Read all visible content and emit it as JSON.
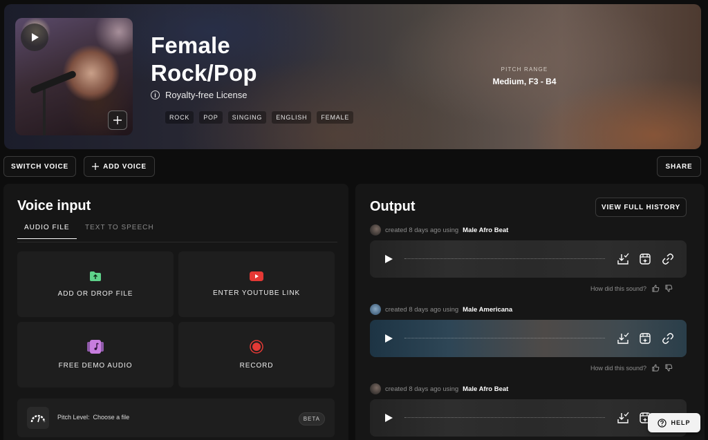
{
  "voice": {
    "title_line1": "Female",
    "title_line2": "Rock/Pop",
    "license": "Royalty-free License",
    "tags": [
      "ROCK",
      "POP",
      "SINGING",
      "ENGLISH",
      "FEMALE"
    ],
    "pitch_range_label": "PITCH RANGE",
    "pitch_range_value": "Medium, F3 - B4"
  },
  "toolbar": {
    "switch_voice": "SWITCH VOICE",
    "add_voice": "ADD VOICE",
    "share": "SHARE"
  },
  "voice_input": {
    "title": "Voice input",
    "tabs": [
      "AUDIO FILE",
      "TEXT TO SPEECH"
    ],
    "active_tab": "AUDIO FILE",
    "cards": {
      "add_file": "ADD OR DROP FILE",
      "youtube": "ENTER YOUTUBE LINK",
      "demo": "FREE DEMO AUDIO",
      "record": "RECORD"
    },
    "pitch_level_label": "Pitch Level:",
    "pitch_level_value": "Choose a file",
    "beta_badge": "BETA"
  },
  "output": {
    "title": "Output",
    "view_history": "VIEW FULL HISTORY",
    "feedback_question": "How did this sound?",
    "items": [
      {
        "created": "created 8 days ago using",
        "voice": "Male Afro Beat"
      },
      {
        "created": "created 8 days ago using",
        "voice": "Male Americana"
      },
      {
        "created": "created 8 days ago using",
        "voice": "Male Afro Beat"
      }
    ]
  },
  "help": "HELP",
  "colors": {
    "youtube_red": "#e53935",
    "record_red": "#e53935",
    "upload_green": "#5ed28a",
    "demo_purple": "#c77dde"
  }
}
